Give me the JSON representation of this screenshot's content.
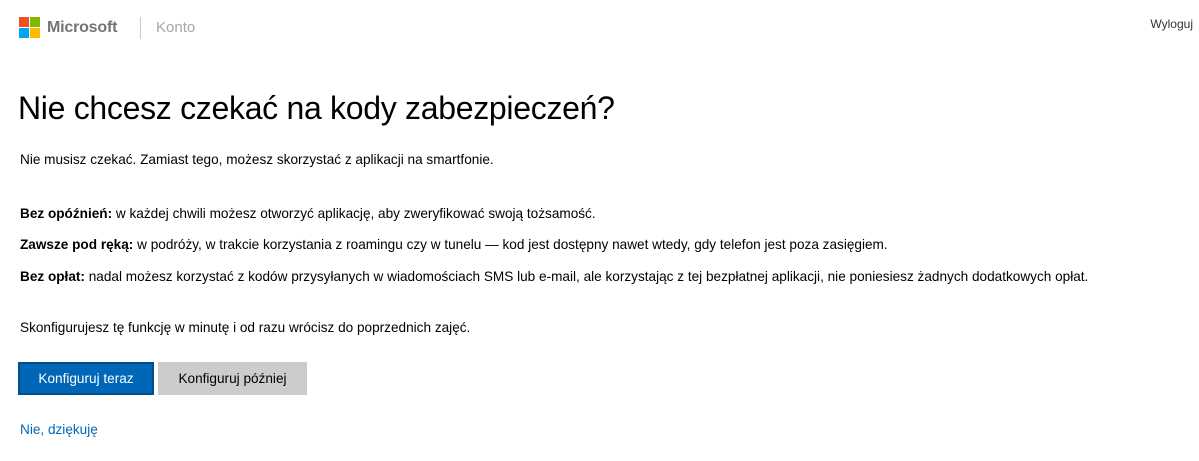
{
  "header": {
    "brand": "Microsoft",
    "section": "Konto",
    "signout_label": "Wyloguj",
    "logo_colors": [
      "#f25022",
      "#7fba00",
      "#00a4ef",
      "#ffb900"
    ]
  },
  "main": {
    "title": "Nie chcesz czekać na kody zabezpieczeń?",
    "intro": "Nie musisz czekać. Zamiast tego, możesz skorzystać z aplikacji na smartfonie.",
    "benefits": [
      {
        "label": "Bez opóźnień:",
        "text": " w każdej chwili możesz otworzyć aplikację, aby zweryfikować swoją tożsamość."
      },
      {
        "label": "Zawsze pod ręką:",
        "text": " w podróży, w trakcie korzystania z roamingu czy w tunelu — kod jest dostępny nawet wtedy, gdy telefon jest poza zasięgiem."
      },
      {
        "label": "Bez opłat:",
        "text": " nadal możesz korzystać z kodów przysyłanych w wiadomościach SMS lub e-mail, ale korzystając z tej bezpłatnej aplikacji, nie poniesiesz żadnych dodatkowych opłat."
      }
    ],
    "closing": "Skonfigurujesz tę funkcję w minutę i od razu wrócisz do poprzednich zajęć.",
    "primary_button": "Konfiguruj teraz",
    "secondary_button": "Konfiguruj później",
    "no_thanks_link": "Nie, dziękuję"
  },
  "colors": {
    "accent": "#0067b8",
    "secondary_button_bg": "#cccccc"
  }
}
